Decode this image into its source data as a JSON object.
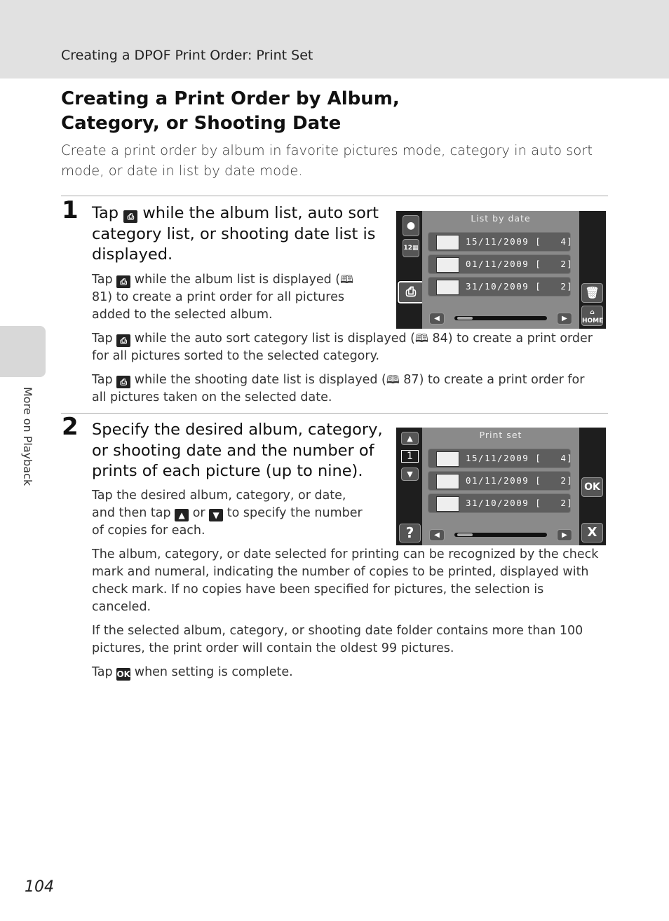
{
  "header": {
    "section": "Creating a DPOF Print Order: Print Set"
  },
  "sidetab": {
    "label": "More on Playback"
  },
  "title": "Creating a Print Order by Album, Category, or Shooting Date",
  "intro": "Create a print order by album in favorite pictures mode, category in auto sort mode, or date in list by date mode.",
  "icons": {
    "print": "print-icon",
    "up": "up-arrow-icon",
    "down": "down-arrow-icon",
    "ok": "ok-icon",
    "book": "book-reference-icon"
  },
  "step1": {
    "num": "1",
    "t1": "Tap ",
    "t2": " while the album list, auto sort category list, or shooting date list is displayed.",
    "p1a": "Tap ",
    "p1b": " while the album list is displayed (",
    "p1c": " 81) to create a print order for all pictures added to the selected album.",
    "p2a": "Tap ",
    "p2b": " while the auto sort category list is displayed (",
    "p2c": " 84) to create a print order for all pictures sorted to the selected category.",
    "p3a": "Tap ",
    "p3b": " while the shooting date list is displayed (",
    "p3c": " 87) to create a print order for all pictures taken on the selected date."
  },
  "step2": {
    "num": "2",
    "title": "Specify the desired album, category, or shooting date and the number of prints of each picture (up to nine).",
    "p1a": "Tap the desired album, category, or date, and then tap ",
    "p1b": " or ",
    "p1c": " to specify the number of copies for each.",
    "p2": "The album, category, or date selected for printing can be recognized by the check mark and numeral, indicating the number of copies to be printed, displayed with check mark. If no copies have been specified for pictures, the selection is canceled.",
    "p3": "If the selected album, category, or shooting date folder contains more than 100 pictures, the print order will contain the oldest 99 pictures.",
    "p4a": "Tap ",
    "p4b": " when setting is complete."
  },
  "screen1": {
    "title": "List by date",
    "rows": [
      "15/11/2009 [   4]",
      "01/11/2009 [   2]",
      "31/10/2009 [   2]"
    ],
    "home": "HOME"
  },
  "screen2": {
    "title": "Print set",
    "rows": [
      "15/11/2009 [   4]",
      "01/11/2009 [   2]",
      "31/10/2009 [   2]"
    ],
    "count": "1",
    "ok": "OK",
    "help": "?",
    "close": "X"
  },
  "page_number": "104"
}
